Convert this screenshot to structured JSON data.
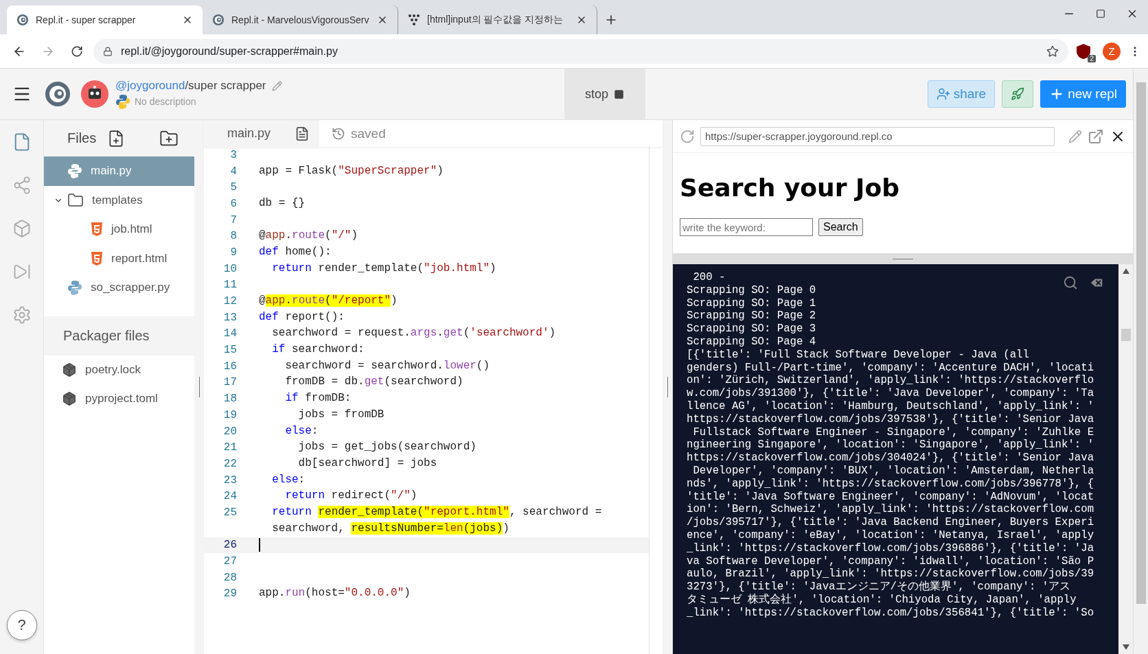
{
  "browser": {
    "tabs": [
      {
        "title": "Repl.it - super scrapper",
        "kind": "repl",
        "selected": true
      },
      {
        "title": "Repl.it - MarvelousVigorousServ",
        "kind": "repl",
        "selected": false
      },
      {
        "title": "[html]input의 필수값을 지정하는",
        "kind": "dots",
        "selected": false
      }
    ],
    "address": "repl.it/@joygoround/super-scrapper#main.py",
    "extension_badge": "2",
    "profile_initial": "Z"
  },
  "repl_header": {
    "owner": "@joygoround",
    "name": "/super scrapper",
    "description": "No description",
    "run_button": "stop",
    "share_button": "share",
    "new_repl_button": "new repl"
  },
  "sidebar": {
    "items": [
      {
        "kind": "files",
        "selected": true
      },
      {
        "kind": "version-control",
        "selected": false
      },
      {
        "kind": "packages",
        "selected": false
      },
      {
        "kind": "debugger",
        "selected": false
      },
      {
        "kind": "settings",
        "selected": false
      }
    ],
    "help_button": "?"
  },
  "files": {
    "title": "Files",
    "tree": [
      {
        "name": "main.py",
        "kind": "python",
        "selected": true
      },
      {
        "name": "templates",
        "kind": "folder",
        "selected": false,
        "expanded": true,
        "children": [
          {
            "name": "job.html",
            "kind": "html",
            "selected": false
          },
          {
            "name": "report.html",
            "kind": "html",
            "selected": false
          }
        ]
      },
      {
        "name": "so_scrapper.py",
        "kind": "python",
        "selected": false
      }
    ],
    "packager_title": "Packager files",
    "packager_files": [
      {
        "name": "poetry.lock"
      },
      {
        "name": "pyproject.toml"
      }
    ]
  },
  "editor": {
    "tab": "main.py",
    "save_status": "saved",
    "lines": [
      {
        "kind": "line",
        "number": "3",
        "current": false
      },
      {
        "kind": "line",
        "number": "4",
        "current": false,
        "tokens": [
          {
            "text": "app = Flask(",
            "kind": "plain",
            "marked": false
          },
          {
            "text": "\"SuperScrapper\"",
            "kind": "string",
            "marked": false
          },
          {
            "text": ")",
            "kind": "plain",
            "marked": false
          }
        ]
      },
      {
        "kind": "line",
        "number": "5",
        "current": false
      },
      {
        "kind": "line",
        "number": "6",
        "current": false,
        "tokens": [
          {
            "text": "db = {}",
            "kind": "plain",
            "marked": false
          }
        ]
      },
      {
        "kind": "line",
        "number": "7",
        "current": false
      },
      {
        "kind": "line",
        "number": "8",
        "current": false,
        "tokens": [
          {
            "text": "@",
            "kind": "plain",
            "marked": false
          },
          {
            "text": "app",
            "kind": "builtin",
            "marked": false
          },
          {
            "text": ".",
            "kind": "plain",
            "marked": false
          },
          {
            "text": "route",
            "kind": "method",
            "marked": false
          },
          {
            "text": "(",
            "kind": "plain",
            "marked": false
          },
          {
            "text": "\"/\"",
            "kind": "string",
            "marked": false
          },
          {
            "text": ")",
            "kind": "plain",
            "marked": false
          }
        ]
      },
      {
        "kind": "line",
        "number": "9",
        "current": false,
        "tokens": [
          {
            "text": "def",
            "kind": "keyword",
            "marked": false
          },
          {
            "text": " home():",
            "kind": "plain",
            "marked": false
          }
        ]
      },
      {
        "kind": "line",
        "number": "10",
        "current": false,
        "tokens": [
          {
            "text": "  return",
            "kind": "keyword",
            "marked": false
          },
          {
            "text": " render_template(",
            "kind": "plain",
            "marked": false
          },
          {
            "text": "\"job.html\"",
            "kind": "string",
            "marked": false
          },
          {
            "text": ")",
            "kind": "plain",
            "marked": false
          }
        ]
      },
      {
        "kind": "line",
        "number": "11",
        "current": false
      },
      {
        "kind": "line",
        "number": "12",
        "current": false,
        "tokens": [
          {
            "text": "@",
            "kind": "plain",
            "marked": false
          },
          {
            "text": "app",
            "kind": "builtin",
            "marked": true
          },
          {
            "text": ".",
            "kind": "plain",
            "marked": true
          },
          {
            "text": "route",
            "kind": "method",
            "marked": true
          },
          {
            "text": "(",
            "kind": "plain",
            "marked": true
          },
          {
            "text": "\"/report\"",
            "kind": "string",
            "marked": true
          },
          {
            "text": ")",
            "kind": "plain",
            "marked": false
          }
        ]
      },
      {
        "kind": "line",
        "number": "13",
        "current": false,
        "tokens": [
          {
            "text": "def",
            "kind": "keyword",
            "marked": false
          },
          {
            "text": " report():",
            "kind": "plain",
            "marked": false
          }
        ]
      },
      {
        "kind": "line",
        "number": "14",
        "current": false,
        "tokens": [
          {
            "text": "  searchword = request.",
            "kind": "plain",
            "marked": false
          },
          {
            "text": "args",
            "kind": "method",
            "marked": false
          },
          {
            "text": ".",
            "kind": "plain",
            "marked": false
          },
          {
            "text": "get",
            "kind": "method",
            "marked": false
          },
          {
            "text": "(",
            "kind": "plain",
            "marked": false
          },
          {
            "text": "'searchword'",
            "kind": "string",
            "marked": false
          },
          {
            "text": ")",
            "kind": "plain",
            "marked": false
          }
        ]
      },
      {
        "kind": "line",
        "number": "15",
        "current": false,
        "tokens": [
          {
            "text": "  if",
            "kind": "keyword",
            "marked": false
          },
          {
            "text": " searchword:",
            "kind": "plain",
            "marked": false
          }
        ]
      },
      {
        "kind": "line",
        "number": "16",
        "current": false,
        "tokens": [
          {
            "text": "    searchword = searchword.",
            "kind": "plain",
            "marked": false
          },
          {
            "text": "lower",
            "kind": "method",
            "marked": false
          },
          {
            "text": "()",
            "kind": "plain",
            "marked": false
          }
        ]
      },
      {
        "kind": "line",
        "number": "17",
        "current": false,
        "tokens": [
          {
            "text": "    fromDB = db.",
            "kind": "plain",
            "marked": false
          },
          {
            "text": "get",
            "kind": "method",
            "marked": false
          },
          {
            "text": "(searchword)",
            "kind": "plain",
            "marked": false
          }
        ]
      },
      {
        "kind": "line",
        "number": "18",
        "current": false,
        "tokens": [
          {
            "text": "    if",
            "kind": "keyword",
            "marked": false
          },
          {
            "text": " fromDB:",
            "kind": "plain",
            "marked": false
          }
        ]
      },
      {
        "kind": "line",
        "number": "19",
        "current": false,
        "tokens": [
          {
            "text": "      jobs = fromDB",
            "kind": "plain",
            "marked": false
          }
        ]
      },
      {
        "kind": "line",
        "number": "20",
        "current": false,
        "tokens": [
          {
            "text": "    else",
            "kind": "keyword",
            "marked": false
          },
          {
            "text": ":",
            "kind": "plain",
            "marked": false
          }
        ]
      },
      {
        "kind": "line",
        "number": "21",
        "current": false,
        "tokens": [
          {
            "text": "      jobs = get_jobs(searchword)",
            "kind": "plain",
            "marked": false
          }
        ]
      },
      {
        "kind": "line",
        "number": "22",
        "current": false,
        "tokens": [
          {
            "text": "      db[searchword] = jobs",
            "kind": "plain",
            "marked": false
          }
        ]
      },
      {
        "kind": "line",
        "number": "23",
        "current": false,
        "tokens": [
          {
            "text": "  else",
            "kind": "keyword",
            "marked": false
          },
          {
            "text": ":",
            "kind": "plain",
            "marked": false
          }
        ]
      },
      {
        "kind": "line",
        "number": "24",
        "current": false,
        "tokens": [
          {
            "text": "    return",
            "kind": "keyword",
            "marked": false
          },
          {
            "text": " redirect(",
            "kind": "plain",
            "marked": false
          },
          {
            "text": "\"/\"",
            "kind": "string",
            "marked": false
          },
          {
            "text": ")",
            "kind": "plain",
            "marked": false
          }
        ]
      },
      {
        "kind": "line",
        "number": "25",
        "current": false,
        "tokens": [
          {
            "text": "  return ",
            "kind": "keyword",
            "marked": false
          },
          {
            "text": "render_template(",
            "kind": "plain",
            "marked": true
          },
          {
            "text": "\"report.html\"",
            "kind": "string",
            "marked": true
          },
          {
            "text": ", searchword =",
            "kind": "plain",
            "marked": false
          }
        ]
      },
      {
        "kind": "wrap",
        "current": false,
        "tokens": [
          {
            "text": "searchword, ",
            "kind": "plain",
            "marked": false
          },
          {
            "text": "resultsNumber=",
            "kind": "plain",
            "marked": true
          },
          {
            "text": "len",
            "kind": "builtin",
            "marked": true
          },
          {
            "text": "(jobs)",
            "kind": "plain",
            "marked": true
          },
          {
            "text": ")",
            "kind": "plain",
            "marked": false
          }
        ]
      },
      {
        "kind": "line",
        "number": "26",
        "current": true
      },
      {
        "kind": "line",
        "number": "27",
        "current": false
      },
      {
        "kind": "line",
        "number": "28",
        "current": false
      },
      {
        "kind": "line",
        "number": "29",
        "current": false,
        "tokens": [
          {
            "text": "app.",
            "kind": "plain",
            "marked": false
          },
          {
            "text": "run",
            "kind": "method",
            "marked": false
          },
          {
            "text": "(host=",
            "kind": "plain",
            "marked": false
          },
          {
            "text": "\"0.0.0.0\"",
            "kind": "string",
            "marked": false
          },
          {
            "text": ")",
            "kind": "plain",
            "marked": false
          }
        ]
      }
    ]
  },
  "webview": {
    "url": "https://super-scrapper.joygoround.repl.co",
    "heading": "Search your Job",
    "search_placeholder": "write the keyword:",
    "search_button": "Search"
  },
  "console": {
    "lines": [
      " 200 -",
      "Scrapping SO: Page 0",
      "Scrapping SO: Page 1",
      "Scrapping SO: Page 2",
      "Scrapping SO: Page 3",
      "Scrapping SO: Page 4",
      "[{'title': 'Full Stack Software Developer - Java (all",
      "genders) Full-/Part-time', 'company': 'Accenture DACH', 'locati",
      "on': 'Zürich, Switzerland', 'apply_link': 'https://stackoverflo",
      "w.com/jobs/391300'}, {'title': 'Java Developer', 'company': 'Ta",
      "llence AG', 'location': 'Hamburg, Deutschland', 'apply_link': '",
      "https://stackoverflow.com/jobs/397538'}, {'title': 'Senior Java",
      " Fullstack Software Engineer - Singapore', 'company': 'Zuhlke E",
      "ngineering Singapore', 'location': 'Singapore', 'apply_link': '",
      "https://stackoverflow.com/jobs/304024'}, {'title': 'Senior Java",
      " Developer', 'company': 'BUX', 'location': 'Amsterdam, Netherla",
      "nds', 'apply_link': 'https://stackoverflow.com/jobs/396778'}, {",
      "'title': 'Java Software Engineer', 'company': 'AdNovum', 'locat",
      "ion': 'Bern, Schweiz', 'apply_link': 'https://stackoverflow.com",
      "/jobs/395717'}, {'title': 'Java Backend Engineer, Buyers Experi",
      "ence', 'company': 'eBay', 'location': 'Netanya, Israel', 'apply",
      "_link': 'https://stackoverflow.com/jobs/396886'}, {'title': 'Ja",
      "va Software Developer', 'company': 'idwall', 'location': 'São P",
      "aulo, Brazil', 'apply_link': 'https://stackoverflow.com/jobs/39",
      "3273'}, {'title': 'Javaエンジニア/その他業界', 'company': 'アス",
      "タミューゼ 株式会社', 'location': 'Chiyoda City, Japan', 'apply",
      "_link': 'https://stackoverflow.com/jobs/356841'}, {'title': 'So"
    ]
  }
}
